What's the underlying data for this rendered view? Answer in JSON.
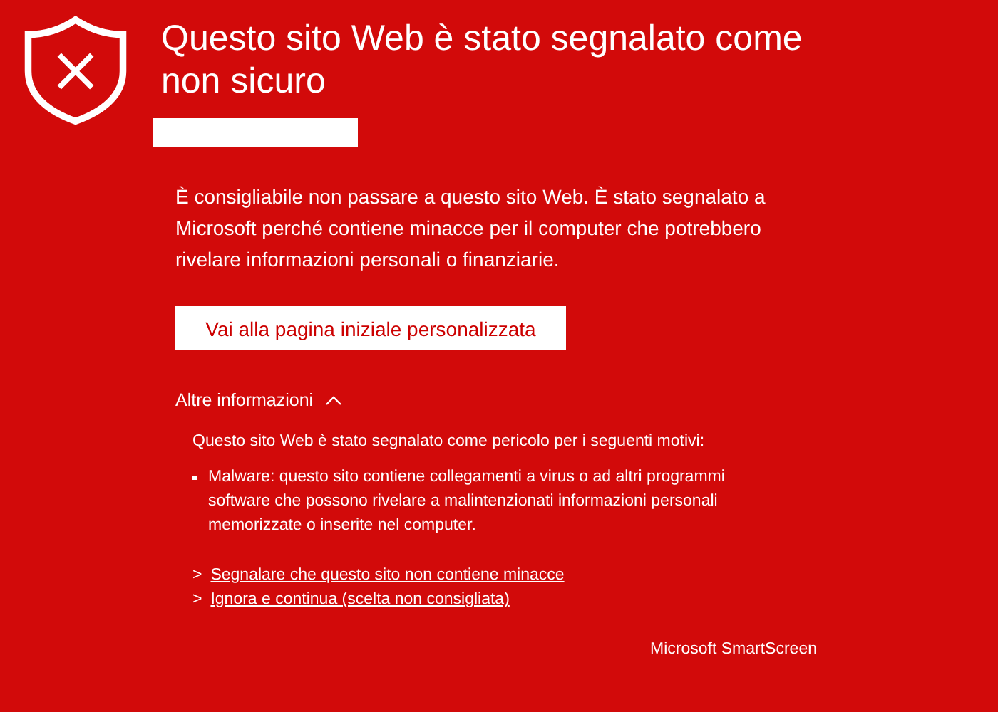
{
  "title": "Questo sito Web è stato segnalato come non sicuro",
  "message": "È consigliabile non passare a questo sito Web. È stato segnalato a Microsoft perché contiene minacce per il computer che potrebbero rivelare informazioni personali o finanziarie.",
  "primary_button": "Vai alla pagina iniziale personalizzata",
  "more_info": {
    "label": "Altre informazioni",
    "expanded": true,
    "intro": "Questo sito Web è stato segnalato come pericolo per i seguenti motivi:",
    "reasons": [
      "Malware: questo sito contiene collegamenti a virus o ad altri programmi software che possono rivelare a malintenzionati informazioni personali memorizzate o inserite nel computer."
    ],
    "links": [
      {
        "marker": ">",
        "label": "Segnalare che questo sito non contiene minacce"
      },
      {
        "marker": ">",
        "label": "Ignora e continua (scelta non consigliata)"
      }
    ]
  },
  "footer": "Microsoft SmartScreen"
}
